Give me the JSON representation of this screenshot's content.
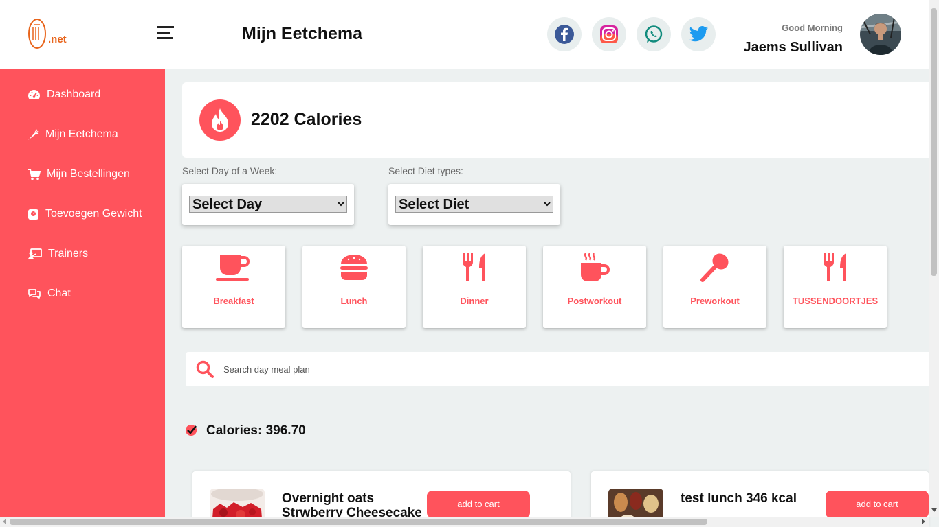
{
  "header": {
    "logo_text": ".net",
    "page_title": "Mijn Eetchema",
    "greeting": "Good Morning",
    "user_name": "Jaems Sullivan",
    "socials": [
      "facebook-icon",
      "instagram-icon",
      "whatsapp-icon",
      "twitter-icon"
    ]
  },
  "sidebar": {
    "items": [
      {
        "label": "Dashboard",
        "icon": "dashboard-gauge-icon"
      },
      {
        "label": "Mijn Eetchema",
        "icon": "carrot-icon"
      },
      {
        "label": "Mijn Bestellingen",
        "icon": "cart-icon"
      },
      {
        "label": "Toevoegen Gewicht",
        "icon": "weight-scale-icon"
      },
      {
        "label": "Trainers",
        "icon": "trainer-board-icon"
      },
      {
        "label": "Chat",
        "icon": "chat-icon"
      }
    ]
  },
  "calories": {
    "value_text": "2202 Calories",
    "icon": "fire-icon"
  },
  "filters": {
    "day_label": "Select Day of a Week:",
    "day_selected": "Select Day",
    "diet_label": "Select Diet types:",
    "diet_selected": "Select Diet"
  },
  "meal_types": [
    {
      "label": "Breakfast",
      "icon": "coffee-cup-icon"
    },
    {
      "label": "Lunch",
      "icon": "burger-icon"
    },
    {
      "label": "Dinner",
      "icon": "fork-knife-icon"
    },
    {
      "label": "Postworkout",
      "icon": "hot-mug-icon"
    },
    {
      "label": "Preworkout",
      "icon": "spoon-icon"
    },
    {
      "label": "TUSSENDOORTJES",
      "icon": "fork-knife-icon"
    }
  ],
  "search": {
    "placeholder": "Search day meal plan"
  },
  "summary": {
    "calories_text": "Calories: 396.70"
  },
  "plans": [
    {
      "name": "Overnight oats Strwberry Cheesecake",
      "button": "add to cart"
    },
    {
      "name": "test lunch 346 kcal",
      "button": "add to cart"
    }
  ],
  "colors": {
    "accent": "#ff535c",
    "background": "#edf1f1",
    "header": "#ffffff"
  }
}
